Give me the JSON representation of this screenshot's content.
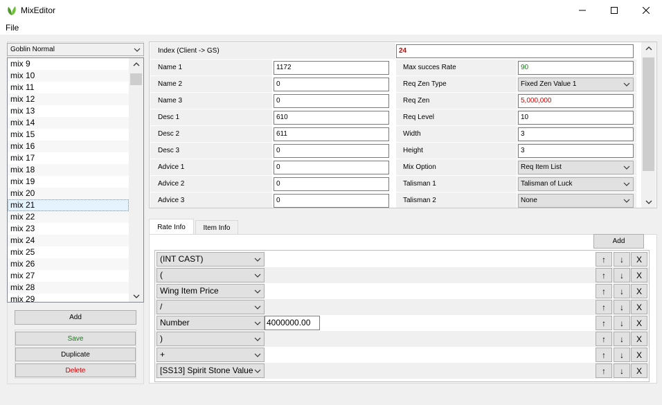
{
  "window": {
    "title": "MixEditor",
    "minimize_glyph": "—",
    "maximize_glyph": "☐",
    "close_glyph": "✕"
  },
  "menu": {
    "file": "File"
  },
  "left": {
    "category": "Goblin Normal",
    "list": [
      "mix 9",
      "mix 10",
      "mix 11",
      "mix 12",
      "mix 13",
      "mix 14",
      "mix 15",
      "mix 16",
      "mix 17",
      "mix 18",
      "mix 19",
      "mix 20",
      "mix 21",
      "mix 22",
      "mix 23",
      "mix 24",
      "mix 25",
      "mix 26",
      "mix 27",
      "mix 28",
      "mix 29"
    ],
    "selected": "mix 21",
    "add_label": "Add",
    "save_label": "Save",
    "duplicate_label": "Duplicate",
    "delete_label": "Delete"
  },
  "grid": {
    "index_label": "Index (Client -> GS)",
    "index_value": "24",
    "left_rows": [
      {
        "label": "Name 1",
        "value": "1172"
      },
      {
        "label": "Name 2",
        "value": "0"
      },
      {
        "label": "Name 3",
        "value": "0"
      },
      {
        "label": "Desc 1",
        "value": "610"
      },
      {
        "label": "Desc 2",
        "value": "611"
      },
      {
        "label": "Desc 3",
        "value": "0"
      },
      {
        "label": "Advice 1",
        "value": "0"
      },
      {
        "label": "Advice 2",
        "value": "0"
      },
      {
        "label": "Advice 3",
        "value": "0"
      }
    ],
    "right_rows": [
      {
        "label": "Max succes Rate",
        "value": "90",
        "kind": "input",
        "color": "#1a7a1a"
      },
      {
        "label": "Req Zen Type",
        "value": "Fixed Zen Value 1",
        "kind": "select",
        "color": "#000000"
      },
      {
        "label": "Req Zen",
        "value": "5,000,000",
        "kind": "input",
        "color": "#d00000"
      },
      {
        "label": "Req Level",
        "value": "10",
        "kind": "input",
        "color": "#000000"
      },
      {
        "label": "Width",
        "value": "3",
        "kind": "input",
        "color": "#000000"
      },
      {
        "label": "Height",
        "value": "3",
        "kind": "input",
        "color": "#000000"
      },
      {
        "label": "Mix Option",
        "value": "Req Item List",
        "kind": "select",
        "color": "#000000"
      },
      {
        "label": "Talisman 1",
        "value": "Talisman of Luck",
        "kind": "select",
        "color": "#000000"
      },
      {
        "label": "Talisman 2",
        "value": "None",
        "kind": "select",
        "color": "#000000"
      }
    ]
  },
  "tabs": [
    {
      "label": "Rate Info"
    },
    {
      "label": "Item Info"
    }
  ],
  "rate": {
    "add_label": "Add",
    "up_glyph": "↑",
    "down_glyph": "↓",
    "remove_glyph": "X",
    "rows": [
      {
        "op": "(INT CAST)",
        "value": ""
      },
      {
        "op": "(",
        "value": ""
      },
      {
        "op": "Wing Item Price",
        "value": ""
      },
      {
        "op": "/",
        "value": ""
      },
      {
        "op": "Number",
        "value": "4000000.00"
      },
      {
        "op": ")",
        "value": ""
      },
      {
        "op": "+",
        "value": ""
      },
      {
        "op": "[SS13] Spirit Stone Value",
        "value": ""
      }
    ]
  },
  "colors": {
    "save": "#1a7a1a",
    "delete": "#d00000",
    "index": "#d00000"
  }
}
